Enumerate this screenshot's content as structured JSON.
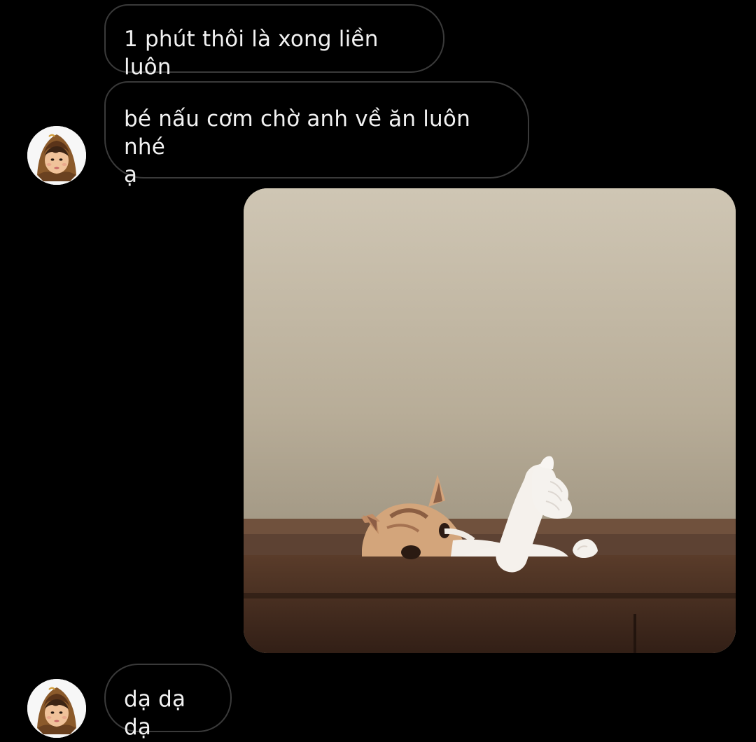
{
  "conversation": {
    "messages": [
      {
        "sender": "other",
        "text": "1 phút thôi là xong liền luôn"
      },
      {
        "sender": "other",
        "text": "bé nấu cơm chờ anh về ăn luôn nhé\nạ"
      },
      {
        "sender": "other",
        "type": "image",
        "image_name": "cat-thumbs-up-photo"
      },
      {
        "sender": "other",
        "text": "dạ dạ dạ"
      }
    ]
  },
  "colors": {
    "background": "#000000",
    "bubble_border": "#3a3a3a",
    "text": "#f2f2f2",
    "avatar_background": "#f7f7f7"
  },
  "icons": {
    "avatar": "cartoon-boy-in-brown-hood-avatar",
    "photo": "cat-giving-thumbs-up-photo"
  }
}
